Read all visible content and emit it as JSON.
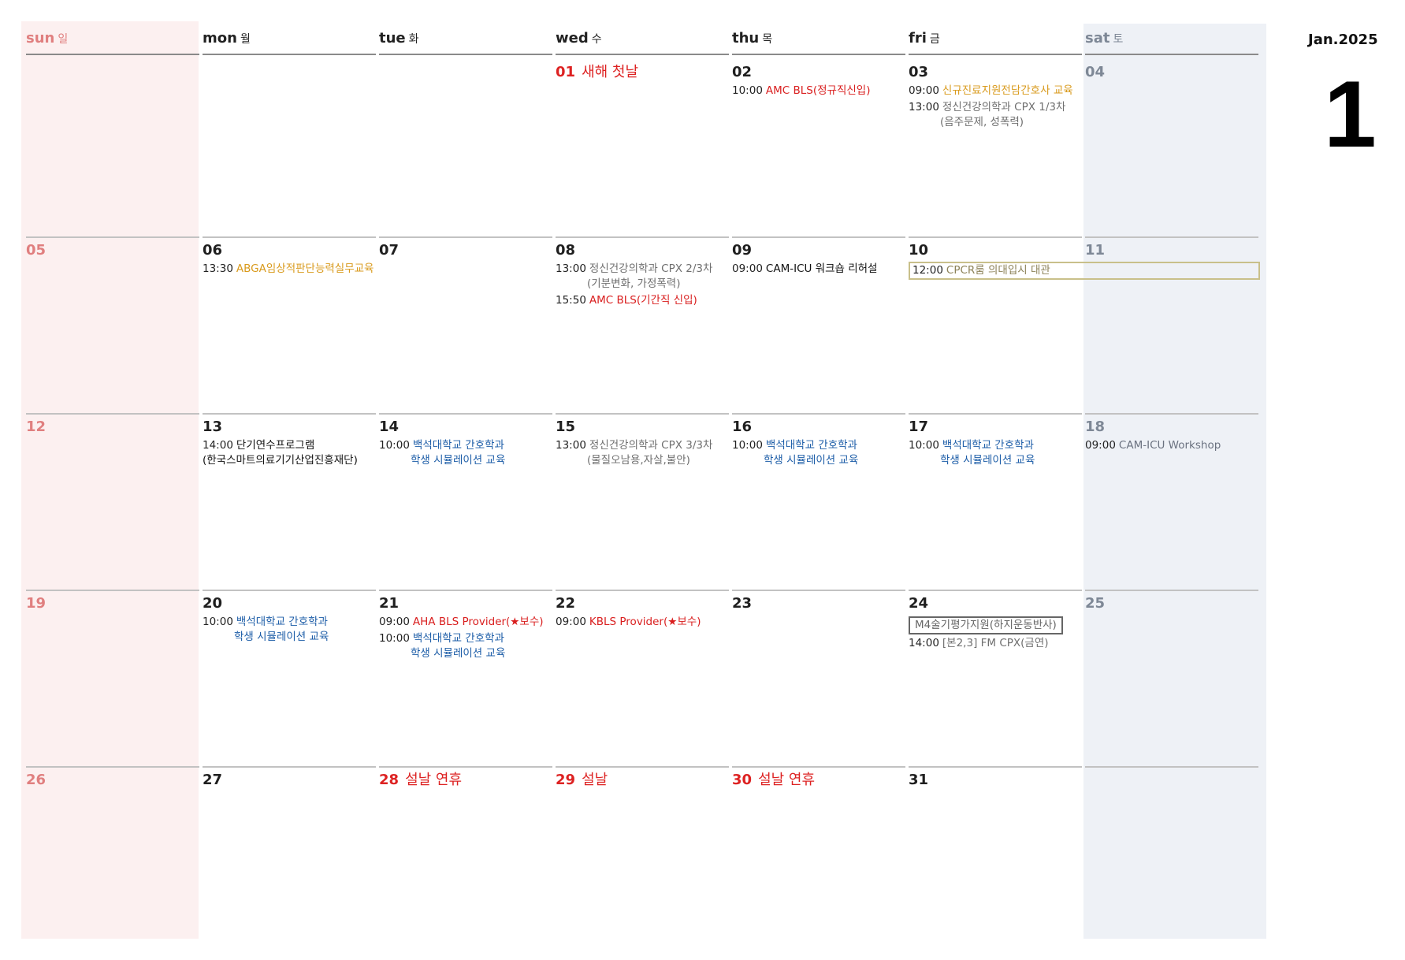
{
  "side": {
    "month_year": "Jan.2025",
    "month_number": "1"
  },
  "weekdays": [
    {
      "en": "sun",
      "ko": "일"
    },
    {
      "en": "mon",
      "ko": "월"
    },
    {
      "en": "tue",
      "ko": "화"
    },
    {
      "en": "wed",
      "ko": "수"
    },
    {
      "en": "thu",
      "ko": "목"
    },
    {
      "en": "fri",
      "ko": "금"
    },
    {
      "en": "sat",
      "ko": "토"
    }
  ],
  "weeks": [
    [
      {
        "day": ""
      },
      {
        "day": ""
      },
      {
        "day": ""
      },
      {
        "day": "01",
        "holiday": "새해 첫날"
      },
      {
        "day": "02",
        "events": [
          {
            "time": "10:00",
            "title": "AMC BLS(정규직신입)",
            "color": "red"
          }
        ]
      },
      {
        "day": "03",
        "events": [
          {
            "time": "09:00",
            "title": "신규진료지원전담간호사 교육",
            "color": "orange"
          },
          {
            "time": "13:00",
            "title": "정신건강의학과 CPX 1/3차",
            "sub": "(음주문제, 성폭력)",
            "color": "gray"
          }
        ]
      },
      {
        "day": "04"
      }
    ],
    [
      {
        "day": "05"
      },
      {
        "day": "06",
        "events": [
          {
            "time": "13:30",
            "title": "ABGA임상적판단능력실무교육",
            "color": "orange"
          }
        ]
      },
      {
        "day": "07"
      },
      {
        "day": "08",
        "events": [
          {
            "time": "13:00",
            "title": "정신건강의학과 CPX 2/3차",
            "sub": "(기분변화, 가정폭력)",
            "color": "gray"
          },
          {
            "time": "15:50",
            "title": "AMC BLS(기간직 신입)",
            "color": "red"
          }
        ]
      },
      {
        "day": "09",
        "events": [
          {
            "time": "09:00",
            "title": "CAM-ICU 워크숍 리허설",
            "color": "dark"
          }
        ]
      },
      {
        "day": "10",
        "bar": {
          "time": "12:00",
          "title": "CPCR룸 의대입시 대관",
          "color": "olive"
        }
      },
      {
        "day": "11"
      }
    ],
    [
      {
        "day": "12"
      },
      {
        "day": "13",
        "events": [
          {
            "time": "14:00",
            "title": "단기연수프로그램",
            "line2": "(한국스마트의료기기산업진흥재단)",
            "color": "dark"
          }
        ]
      },
      {
        "day": "14",
        "events": [
          {
            "time": "10:00",
            "title": "백석대학교 간호학과",
            "sub": "학생 시뮬레이션 교육",
            "color": "blue"
          }
        ]
      },
      {
        "day": "15",
        "events": [
          {
            "time": "13:00",
            "title": "정신건강의학과 CPX 3/3차",
            "sub": "(물질오남용,자살,불안)",
            "color": "gray"
          }
        ]
      },
      {
        "day": "16",
        "events": [
          {
            "time": "10:00",
            "title": "백석대학교 간호학과",
            "sub": "학생 시뮬레이션 교육",
            "color": "blue"
          }
        ]
      },
      {
        "day": "17",
        "events": [
          {
            "time": "10:00",
            "title": "백석대학교 간호학과",
            "sub": "학생 시뮬레이션 교육",
            "color": "blue"
          }
        ]
      },
      {
        "day": "18",
        "events": [
          {
            "time": "09:00",
            "title": "CAM-ICU Workshop",
            "color": "slate",
            "time_color": "slate"
          }
        ]
      }
    ],
    [
      {
        "day": "19"
      },
      {
        "day": "20",
        "events": [
          {
            "time": "10:00",
            "title": "백석대학교 간호학과",
            "sub": "학생 시뮬레이션 교육",
            "color": "blue"
          }
        ]
      },
      {
        "day": "21",
        "events": [
          {
            "time": "09:00",
            "title": "AHA BLS Provider(★보수)",
            "color": "red"
          },
          {
            "time": "10:00",
            "title": "백석대학교 간호학과",
            "sub": "학생 시뮬레이션 교육",
            "color": "blue"
          }
        ]
      },
      {
        "day": "22",
        "events": [
          {
            "time": "09:00",
            "title": "KBLS Provider(★보수)",
            "color": "red"
          }
        ]
      },
      {
        "day": "23"
      },
      {
        "day": "24",
        "boxed": "M4술기평가지원(하지운동반사)",
        "events": [
          {
            "time": "14:00",
            "title": "[본2,3] FM CPX(금연)",
            "color": "gray"
          }
        ]
      },
      {
        "day": "25"
      }
    ],
    [
      {
        "day": "26"
      },
      {
        "day": "27"
      },
      {
        "day": "28",
        "holiday": "설날 연휴"
      },
      {
        "day": "29",
        "holiday": "설날"
      },
      {
        "day": "30",
        "holiday": "설날 연휴"
      },
      {
        "day": "31"
      },
      {
        "day": ""
      }
    ]
  ]
}
